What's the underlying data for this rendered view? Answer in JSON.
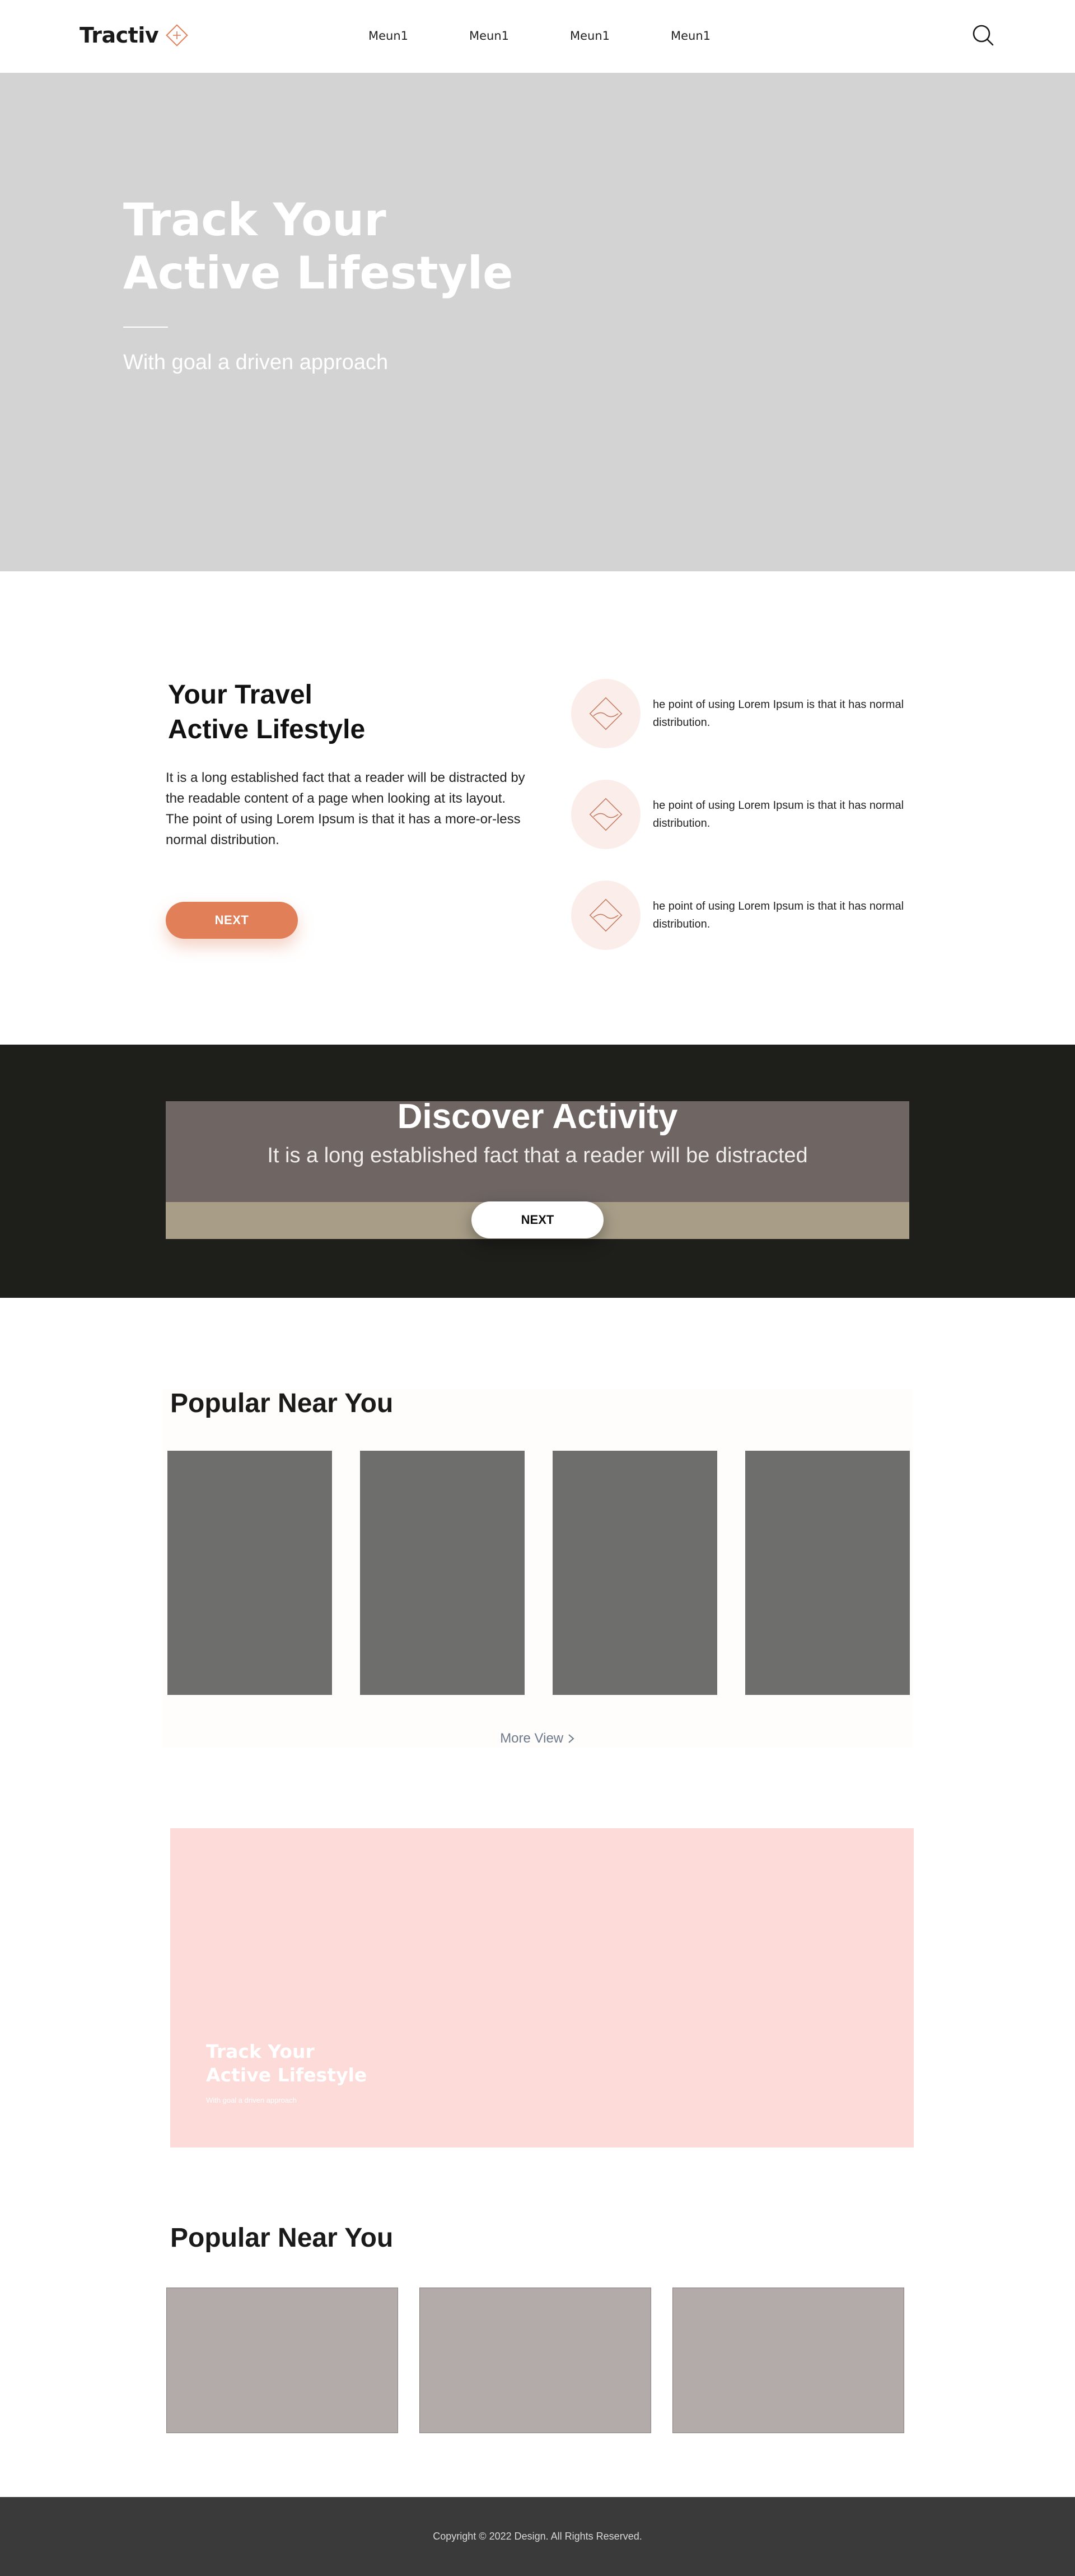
{
  "header": {
    "logo_text": "Tractiv",
    "nav": [
      "Meun1",
      "Meun1",
      "Meun1",
      "Meun1"
    ],
    "search_icon": "search-icon"
  },
  "hero": {
    "title_line1": "Track Your",
    "title_line2": "Active Lifestyle",
    "subtitle": "With goal a driven approach"
  },
  "travel": {
    "title_line1": "Your Travel",
    "title_line2": "Active Lifestyle",
    "text": "It is a long established fact that a reader will be distracted by the readable content of a page when looking at its layout. The point of using Lorem Ipsum is that it has a more-or-less normal distribution.",
    "button_label": "NEXT",
    "features": [
      {
        "icon": "diamond-icon",
        "text": "he point of using Lorem Ipsum is that it has  normal distribution."
      },
      {
        "icon": "diamond-icon",
        "text": "he point of using Lorem Ipsum is that it has  normal distribution."
      },
      {
        "icon": "diamond-icon",
        "text": "he point of using Lorem Ipsum is that it has  normal distribution."
      }
    ]
  },
  "discover": {
    "title": "Discover Activity",
    "subtitle": "It is a long established fact that a reader will be distracted",
    "button_label": "NEXT"
  },
  "popular1": {
    "title": "Popular Near You",
    "more_view": "More View"
  },
  "promo": {
    "title_line1": "Track Your",
    "title_line2": "Active Lifestyle",
    "subtitle": "With goal a driven approach"
  },
  "popular2": {
    "title": "Popular Near You"
  },
  "footer": {
    "copyright": "Copyright © 2022 Design. All Rights Reserved."
  },
  "colors": {
    "accent": "#e07f58",
    "hero_bg": "#d3d3d3",
    "discover_bg": "#1e1e1b",
    "promo_bg": "#fcdbd9",
    "footer_bg": "#3a3a3a"
  }
}
